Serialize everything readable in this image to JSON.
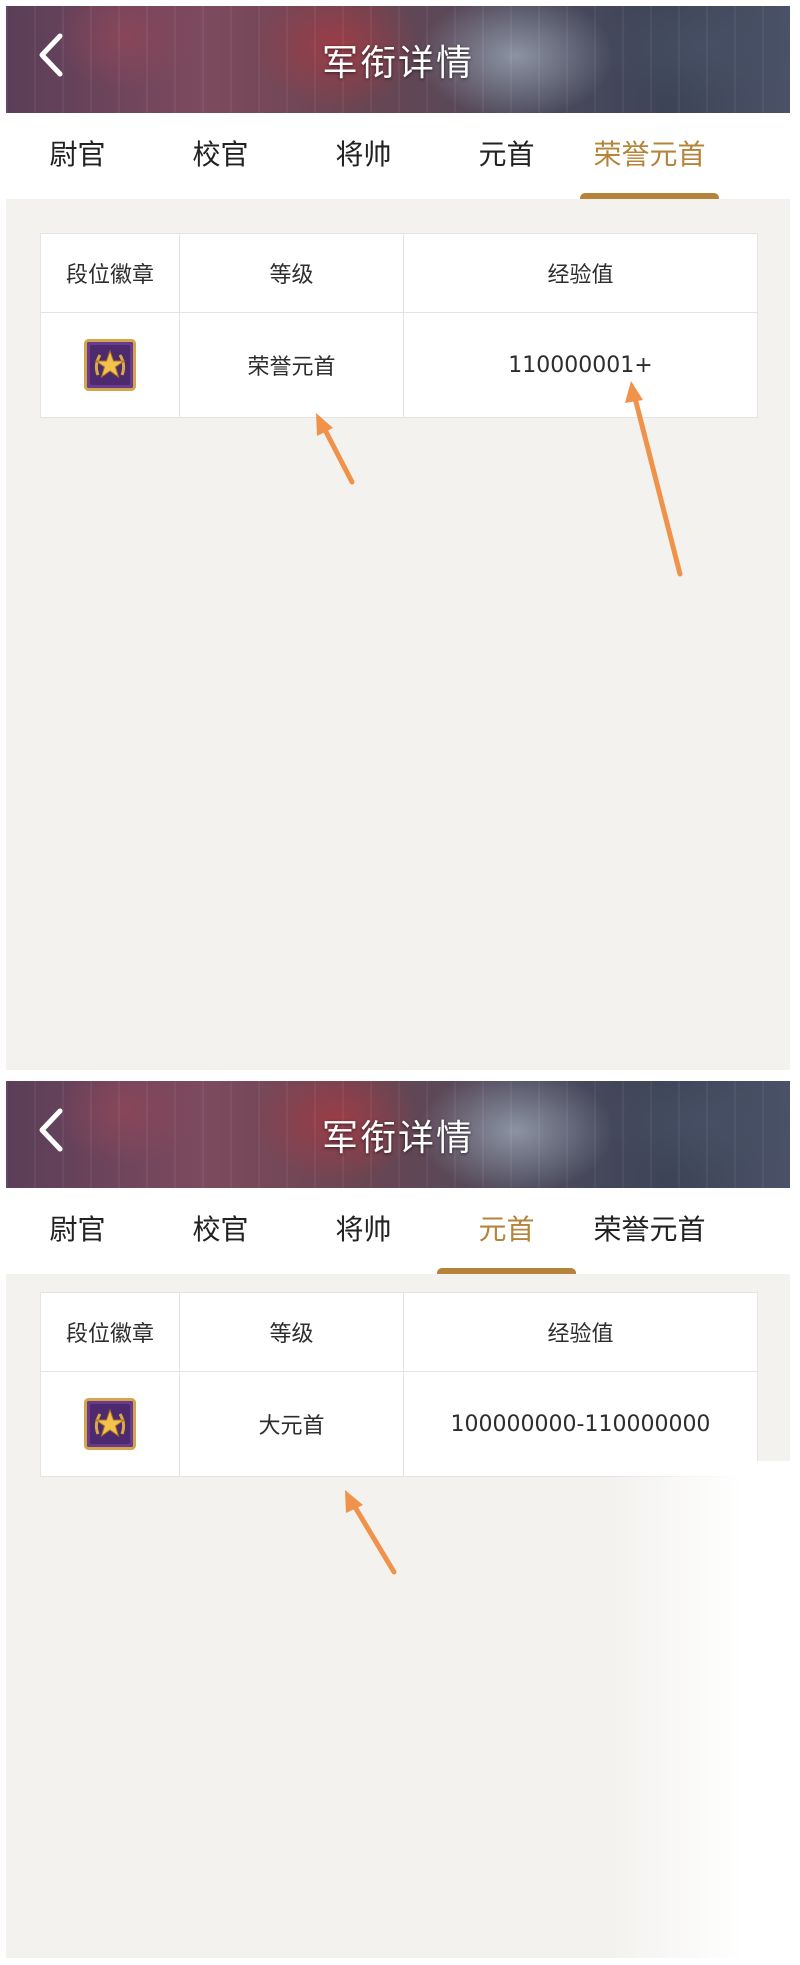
{
  "screens": [
    {
      "header_title": "军衔详情",
      "tabs": [
        "尉官",
        "校官",
        "将帅",
        "元首",
        "荣誉元首"
      ],
      "active_tab": "荣誉元首",
      "table": {
        "headers": [
          "段位徽章",
          "等级",
          "经验值"
        ],
        "row": {
          "badge_icon": "star-laurel-badge-icon",
          "rank": "荣誉元首",
          "exp": "110000001+"
        }
      }
    },
    {
      "header_title": "军衔详情",
      "tabs": [
        "尉官",
        "校官",
        "将帅",
        "元首",
        "荣誉元首"
      ],
      "active_tab": "元首",
      "table": {
        "headers": [
          "段位徽章",
          "等级",
          "经验值"
        ],
        "row": {
          "badge_icon": "star-laurel-badge-icon",
          "rank": "大元首",
          "exp": "100000000-110000000"
        }
      }
    }
  ],
  "colors": {
    "accent": "#b5843a",
    "arrow": "#f0924a",
    "page_bg": "#f3f2ef",
    "badge_purple": "#6a3a8e"
  }
}
